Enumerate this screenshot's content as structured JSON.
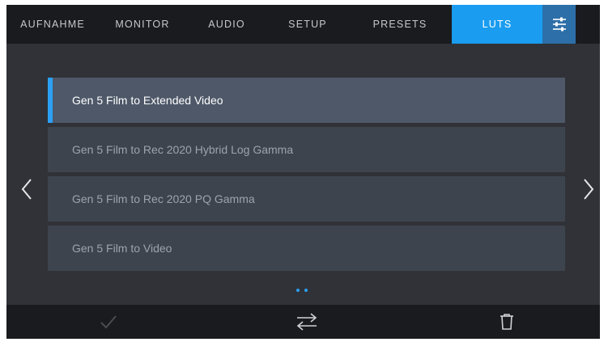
{
  "tabs": [
    {
      "label": "AUFNAHME",
      "active": false
    },
    {
      "label": "MONITOR",
      "active": false
    },
    {
      "label": "AUDIO",
      "active": false
    },
    {
      "label": "SETUP",
      "active": false
    },
    {
      "label": "PRESETS",
      "active": false
    },
    {
      "label": "LUTS",
      "active": true
    }
  ],
  "settings_icon": "sliders-icon",
  "luts": [
    {
      "name": "Gen 5 Film to Extended Video",
      "selected": true
    },
    {
      "name": "Gen 5 Film to Rec 2020 Hybrid Log Gamma",
      "selected": false
    },
    {
      "name": "Gen 5 Film to Rec 2020 PQ Gamma",
      "selected": false
    },
    {
      "name": "Gen 5 Film to Video",
      "selected": false
    }
  ],
  "page_indicator": {
    "pages": 2
  },
  "bottom_actions": [
    {
      "icon": "check-icon",
      "enabled": false
    },
    {
      "icon": "swap-arrows-icon",
      "enabled": true
    },
    {
      "icon": "trash-icon",
      "enabled": true
    }
  ],
  "colors": {
    "accent": "#1a9cf0",
    "tab_bar_bg": "#1a1b1e",
    "content_bg": "#303237",
    "item_bg": "#3e444e",
    "item_selected_bg": "#4e5868"
  }
}
